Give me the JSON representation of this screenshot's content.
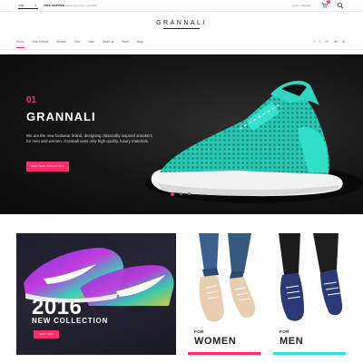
{
  "topbar": {
    "currency": "USD",
    "shipping_bold": "FREE SHIPPING",
    "shipping_text": "across all orders over €79",
    "login": "Login / Register",
    "cart_count": "0"
  },
  "logo": {
    "text": "GRANNALI"
  },
  "nav": {
    "items": [
      "Home",
      "New Arrivals",
      "Women",
      "Men",
      "Sale",
      "About us",
      "Store",
      "Blog"
    ],
    "social": [
      "f",
      "t",
      "G+",
      "Bē",
      "in"
    ]
  },
  "hero": {
    "number": "01",
    "title": "GRANNALI",
    "description": "We are the new footwear brand, designing classically inspired sneakers for men and women. Grannali uses only high quality, luxury materials.",
    "button": "VIEW NEW COLLECTION",
    "slide_count": 3,
    "active_slide": 1
  },
  "tiles": {
    "collection": {
      "year": "2016",
      "subtitle": "NEW COLLECTION",
      "button": "SHOP NOW"
    },
    "women": {
      "for": "FOR",
      "label": "WOMEN",
      "accent": "#ff2d6a"
    },
    "men": {
      "for": "FOR",
      "label": "MEN",
      "accent": "#27e6e6"
    }
  },
  "colors": {
    "accent": "#ff2d6a",
    "teal": "#27e6e6"
  }
}
